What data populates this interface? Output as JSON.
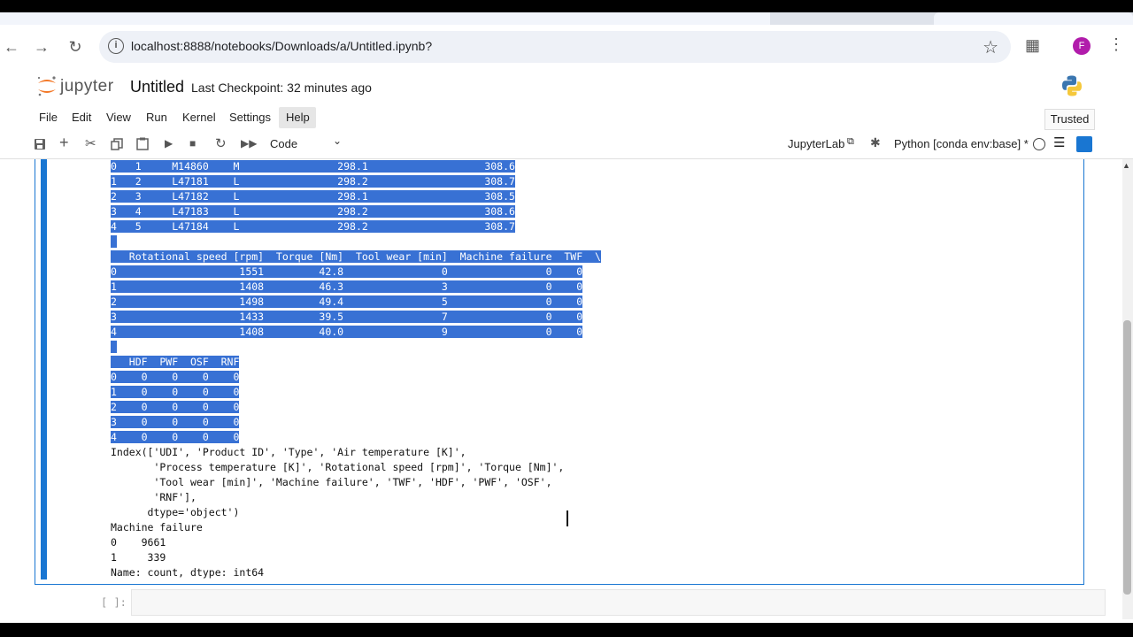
{
  "browser": {
    "url": "localhost:8888/notebooks/Downloads/a/Untitled.ipynb?",
    "profile_initial": "F",
    "icons": [
      "back-arrow-icon",
      "forward-arrow-icon",
      "reload-icon",
      "info-icon",
      "star-icon",
      "extensions-icon",
      "kebab-menu-icon"
    ]
  },
  "header": {
    "brand": "jupyter",
    "notebook_title": "Untitled",
    "checkpoint": "Last Checkpoint: 32 minutes ago"
  },
  "menu": {
    "file": "File",
    "edit": "Edit",
    "view": "View",
    "run": "Run",
    "kernel": "Kernel",
    "settings": "Settings",
    "help": "Help",
    "trusted": "Trusted"
  },
  "toolbar": {
    "cell_type": "Code",
    "jupyterlab": "JupyterLab",
    "kernel_name": "Python [conda env:base] *"
  },
  "output": {
    "table1_rows": [
      "0   1     M14860    M                298.1                   308.6",
      "1   2     L47181    L                298.2                   308.7",
      "2   3     L47182    L                298.1                   308.5",
      "3   4     L47183    L                298.2                   308.6",
      "4   5     L47184    L                298.2                   308.7"
    ],
    "table2_header": "   Rotational speed [rpm]  Torque [Nm]  Tool wear [min]  Machine failure  TWF  \\",
    "table2_rows": [
      "0                    1551         42.8                0                0    0",
      "1                    1408         46.3                3                0    0",
      "2                    1498         49.4                5                0    0",
      "3                    1433         39.5                7                0    0",
      "4                    1408         40.0                9                0    0"
    ],
    "table3_header": "   HDF  PWF  OSF  RNF",
    "table3_rows": [
      "0    0    0    0    0",
      "1    0    0    0    0",
      "2    0    0    0    0",
      "3    0    0    0    0",
      "4    0    0    0    0"
    ],
    "index_lines": [
      "Index(['UDI', 'Product ID', 'Type', 'Air temperature [K]',",
      "       'Process temperature [K]', 'Rotational speed [rpm]', 'Torque [Nm]',",
      "       'Tool wear [min]', 'Machine failure', 'TWF', 'HDF', 'PWF', 'OSF',",
      "       'RNF'],",
      "      dtype='object')"
    ],
    "counts_lines": [
      "Machine failure",
      "0    9661",
      "1     339",
      "Name: count, dtype: int64"
    ]
  },
  "empty_cell": {
    "prompt": "[ ]:"
  }
}
